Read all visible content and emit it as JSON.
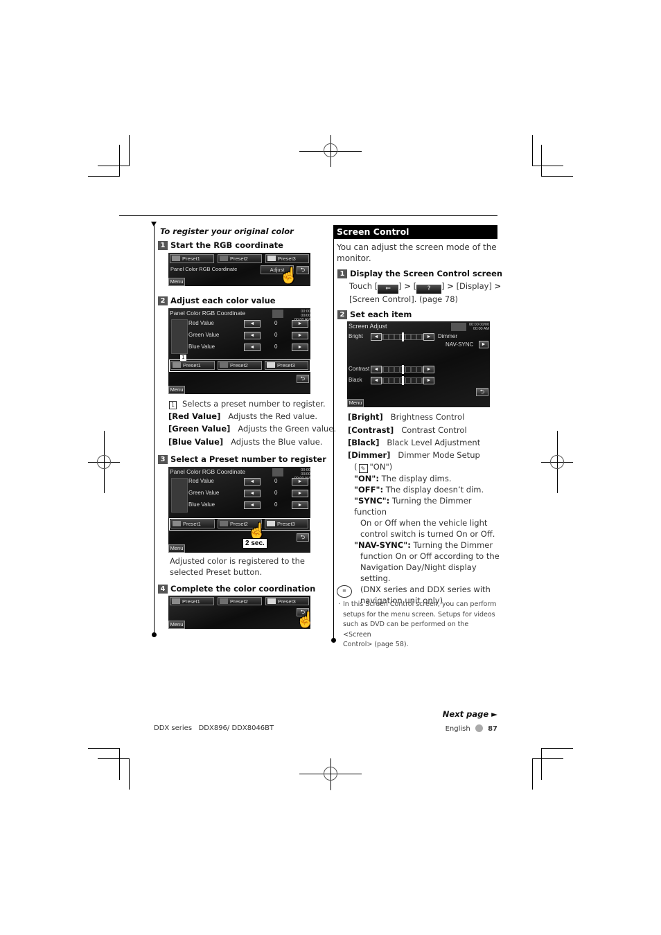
{
  "left": {
    "section_title": "To register your original color",
    "steps": [
      {
        "num": "1",
        "title": "Start the RGB coordinate"
      },
      {
        "num": "2",
        "title": "Adjust each color value"
      },
      {
        "num": "3",
        "title": "Select a Preset number to register"
      },
      {
        "num": "4",
        "title": "Complete the color coordination"
      }
    ],
    "screen": {
      "title": "Panel Color RGB Coordinate",
      "presets": [
        "Preset1",
        "Preset2",
        "Preset3"
      ],
      "preset_colors": [
        "#8a8a8a",
        "#6e6e6e",
        "#d8d8d8"
      ],
      "adjust_label": "Adjust",
      "menu_label": "Menu",
      "clock": [
        "00:00 00/00",
        "00:00 AM"
      ],
      "rows": [
        {
          "label": "Red Value",
          "value": "0"
        },
        {
          "label": "Green Value",
          "value": "0"
        },
        {
          "label": "Blue Value",
          "value": "0"
        }
      ],
      "left_arrow": "◄",
      "right_arrow": "►",
      "back": "⮌",
      "callout": "1",
      "hold_label": "2 sec."
    },
    "descriptions": [
      {
        "key": "1",
        "text": "Selects a preset number to register."
      },
      {
        "key": "[Red Value]",
        "text": "Adjusts the Red value."
      },
      {
        "key": "[Green Value]",
        "text": "Adjusts the Green value."
      },
      {
        "key": "[Blue Value]",
        "text": "Adjusts the Blue value."
      }
    ],
    "step3_note": [
      "Adjusted color is registered to the",
      "selected Preset button."
    ]
  },
  "right": {
    "section_title": "Screen Control",
    "intro": [
      "You can adjust the screen mode of the",
      "monitor."
    ],
    "steps": [
      {
        "num": "1",
        "title": "Display the Screen Control screen"
      },
      {
        "num": "2",
        "title": "Set each item"
      }
    ],
    "step1_text": {
      "touch": "Touch [",
      "bracket_close": "]",
      "sep": ">",
      "open": "[",
      "display": "[Display]",
      "line2": "[Screen Control]. (page 78)"
    },
    "screen": {
      "title": "Screen Adjust",
      "clock": [
        "00:00 00/00",
        "00:00 AM"
      ],
      "rows": [
        "Bright",
        "Contrast",
        "Black"
      ],
      "dimmer_label": "Dimmer",
      "dimmer_value": "NAV-SYNC",
      "menu_label": "Menu",
      "left_arrow": "◄",
      "right_arrow": "►",
      "back": "⮌"
    },
    "items": [
      {
        "key": "[Bright]",
        "text": "Brightness Control"
      },
      {
        "key": "[Contrast]",
        "text": "Contrast Control"
      },
      {
        "key": "[Black]",
        "text": "Black Level Adjustment"
      },
      {
        "key": "[Dimmer]",
        "text": "Dimmer Mode Setup"
      }
    ],
    "dimmer_default": "\"ON\")",
    "dimmer_options": [
      {
        "key": "\"ON\":",
        "lines": [
          "The display dims."
        ]
      },
      {
        "key": "\"OFF\":",
        "lines": [
          "The display doesn’t dim."
        ]
      },
      {
        "key": "\"SYNC\":",
        "lines": [
          "Turning the Dimmer function",
          "On or Off when the vehicle light",
          "control switch is turned On or Off."
        ]
      },
      {
        "key": "\"NAV-SYNC\":",
        "lines": [
          "Turning the Dimmer",
          "function On or Off according to the",
          "Navigation Day/Night display setting.",
          "(DNX series and DDX series with",
          "navigation unit only)"
        ]
      }
    ],
    "note_lines": [
      "In this Screen Control screen, you can perform",
      "setups for the menu screen. Setups for videos",
      "such as DVD can be performed on the <Screen",
      "Control> (page 58)."
    ]
  },
  "footer": {
    "next_page": "Next page ►",
    "series": "DDX series   DDX896/ DDX8046BT",
    "language": "English",
    "page_number": "87"
  }
}
